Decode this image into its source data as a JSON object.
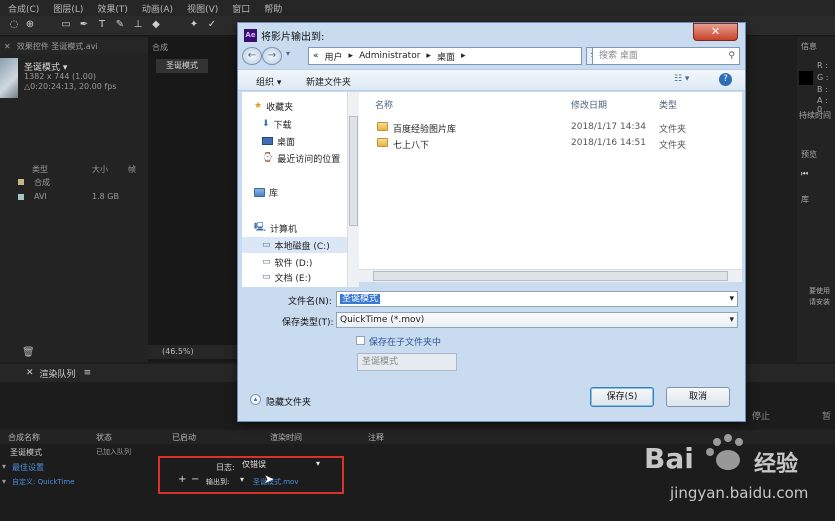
{
  "app": {
    "menu": [
      "合成(C)",
      "图层(L)",
      "效果(T)",
      "动画(A)",
      "视图(V)",
      "窗口",
      "帮助"
    ],
    "project": {
      "tabs": [
        "效果控件 圣诞模式.avi"
      ],
      "comp_name": "圣诞模式 ▾",
      "comp_dims": "1382 x 744 (1.00)",
      "comp_duration": "△0:20:24:13, 20.00 fps",
      "columns": {
        "type": "类型",
        "size": "大小",
        "frame": "帧"
      },
      "rows": [
        {
          "type": "合成",
          "size": ""
        },
        {
          "type": "AVI",
          "size": "1.8 GB"
        }
      ]
    },
    "comp_panel": {
      "header": "合成",
      "tab": "圣诞模式",
      "zoom": "(46.5%)"
    },
    "right_panel": {
      "info": "信息",
      "r": "R :",
      "g": "G :",
      "b": "B :",
      "a": "A : 0",
      "duration": "持续时间",
      "preview": "预览",
      "library": "库",
      "lib_note1": "要使用",
      "lib_note2": "请安装"
    },
    "render_queue": {
      "tab": "渲染队列",
      "headers": [
        "合成名称",
        "状态",
        "已启动",
        "渲染时间",
        "注释"
      ],
      "row_name": "圣诞模式",
      "row_status": "已加入队列",
      "render_settings": "最佳设置",
      "output_module": "自定义: QuickTime",
      "log_label": "日志:",
      "log_value": "仅错误",
      "output_to_label": "输出到:",
      "output_to_value": "圣诞模式.mov",
      "stop": "停止",
      "pause": "暂"
    }
  },
  "dialog": {
    "title": "将影片输出到:",
    "address": [
      "«",
      "用户",
      "Administrator",
      "桌面"
    ],
    "search_placeholder": "搜索 桌面",
    "organize": "组织 ▾",
    "new_folder": "新建文件夹",
    "nav": {
      "favorites": "收藏夹",
      "downloads": "下载",
      "desktop": "桌面",
      "recent": "最近访问的位置",
      "libraries": "库",
      "computer": "计算机",
      "c_drive": "本地磁盘 (C:)",
      "d_drive": "软件 (D:)",
      "e_drive": "文档 (E:)"
    },
    "columns": {
      "name": "名称",
      "date": "修改日期",
      "type": "类型"
    },
    "files": [
      {
        "name": "百度经验图片库",
        "date": "2018/1/17 14:34",
        "type": "文件夹"
      },
      {
        "name": "七上八下",
        "date": "2018/1/16 14:51",
        "type": "文件夹"
      }
    ],
    "filename_label": "文件名(N):",
    "filename_value": "圣诞模式",
    "savetype_label": "保存类型(T):",
    "savetype_value": "QuickTime (*.mov)",
    "subfolder_label": "保存在子文件夹中",
    "subfolder_value": "圣诞模式",
    "hide_folders": "隐藏文件夹",
    "save": "保存(S)",
    "cancel": "取消"
  },
  "watermark": {
    "brand": "Bai",
    "brand_cn": "经验",
    "url": "jingyan.baidu.com"
  },
  "colors": {
    "accent": "#3a78d2",
    "highlight_box": "#d9322a",
    "ae_icon": "#3a0e6e"
  }
}
